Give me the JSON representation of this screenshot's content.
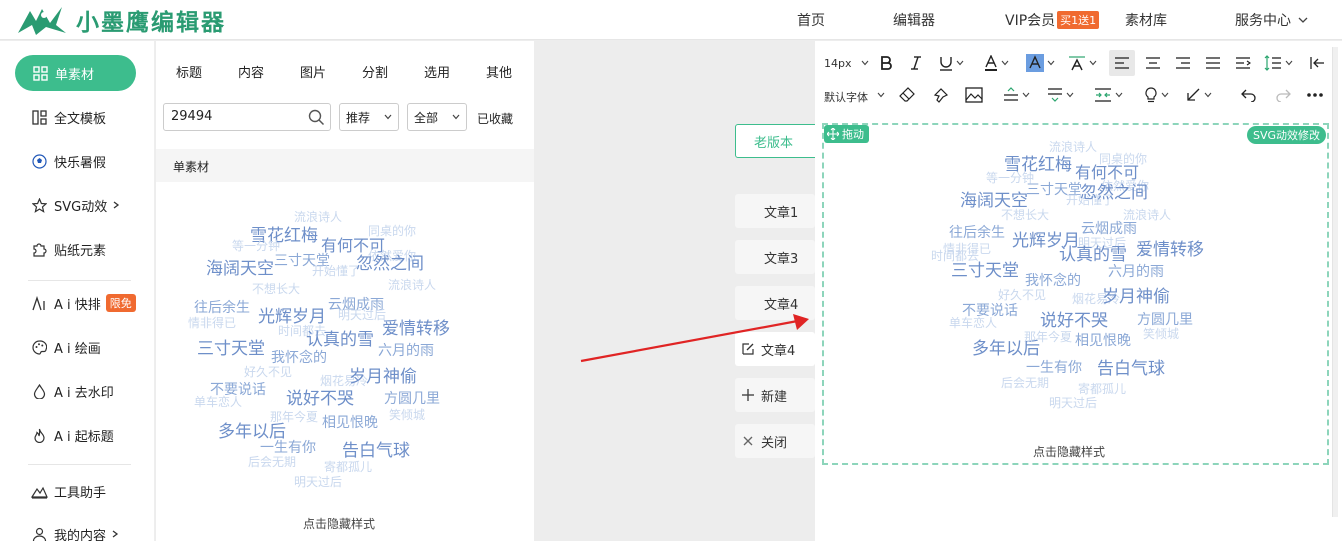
{
  "app": {
    "title": "小墨鹰编辑器",
    "brand_color": "#2a9b72",
    "accent": "#3dbd8d"
  },
  "topnav": {
    "home": "首页",
    "editor": "编辑器",
    "vip": "VIP会员",
    "vip_badge": "买1送1",
    "library": "素材库",
    "service": "服务中心"
  },
  "sidebar": {
    "items": [
      {
        "label": "单素材",
        "icon": "grid-icon"
      },
      {
        "label": "全文模板",
        "icon": "template-icon"
      },
      {
        "label": "快乐暑假",
        "icon": "ball-icon"
      },
      {
        "label": "SVG动效",
        "icon": "star-icon"
      },
      {
        "label": "贴纸元素",
        "icon": "puzzle-icon"
      },
      {
        "label": "A i 快排",
        "icon": "ai-icon",
        "badge": "限免"
      },
      {
        "label": "A i 绘画",
        "icon": "palette-icon"
      },
      {
        "label": "A i 去水印",
        "icon": "drop-icon"
      },
      {
        "label": "A i 起标题",
        "icon": "flame-icon"
      },
      {
        "label": "工具助手",
        "icon": "tool-icon"
      },
      {
        "label": "我的内容",
        "icon": "user-icon"
      }
    ]
  },
  "panel": {
    "tabs": [
      "标题",
      "内容",
      "图片",
      "分割",
      "选用",
      "其他"
    ],
    "search": {
      "value": "29494",
      "placeholder": ""
    },
    "sort": "推荐",
    "filter": "全部",
    "collected": "已收藏",
    "section": "单素材"
  },
  "cloud": {
    "hint": "点击隐藏样式",
    "words": [
      {
        "t": "流浪诗人",
        "s": "l"
      },
      {
        "t": "雪花红梅",
        "s": "x"
      },
      {
        "t": "同桌的你",
        "s": "l"
      },
      {
        "t": "有何不可",
        "s": "b"
      },
      {
        "t": "等一分钟",
        "s": "l"
      },
      {
        "t": "三寸天堂",
        "s": "m"
      },
      {
        "t": "依然爱你",
        "s": "l"
      },
      {
        "t": "海阔天空",
        "s": "x"
      },
      {
        "t": "开始懂了",
        "s": "l"
      },
      {
        "t": "忽然之间",
        "s": "x"
      },
      {
        "t": "不想长大",
        "s": "l"
      },
      {
        "t": "流浪诗人",
        "s": "l"
      },
      {
        "t": "往后余生",
        "s": "m"
      },
      {
        "t": "云烟成雨",
        "s": "m"
      },
      {
        "t": "情非得已",
        "s": "l"
      },
      {
        "t": "光辉岁月",
        "s": "x"
      },
      {
        "t": "明天过后",
        "s": "l"
      },
      {
        "t": "爱情转移",
        "s": "x"
      },
      {
        "t": "时间都去",
        "s": "l"
      },
      {
        "t": "认真的雪",
        "s": "x"
      },
      {
        "t": "三寸天堂",
        "s": "x"
      },
      {
        "t": "六月的雨",
        "s": "m"
      },
      {
        "t": "我怀念的",
        "s": "m"
      },
      {
        "t": "好久不见",
        "s": "l"
      },
      {
        "t": "烟花易冷",
        "s": "l"
      },
      {
        "t": "岁月神偷",
        "s": "x"
      },
      {
        "t": "不要说话",
        "s": "m"
      },
      {
        "t": "单车恋人",
        "s": "l"
      },
      {
        "t": "说好不哭",
        "s": "x"
      },
      {
        "t": "方圆几里",
        "s": "m"
      },
      {
        "t": "笑倾城",
        "s": "l"
      },
      {
        "t": "相见恨晚",
        "s": "m"
      },
      {
        "t": "多年以后",
        "s": "x"
      },
      {
        "t": "那年今夏",
        "s": "l"
      },
      {
        "t": "一生有你",
        "s": "m"
      },
      {
        "t": "告白气球",
        "s": "x"
      },
      {
        "t": "后会无期",
        "s": "l"
      },
      {
        "t": "寄都孤儿",
        "s": "l"
      },
      {
        "t": "明天过后",
        "s": "l"
      }
    ]
  },
  "middle": {
    "old_version": "老版本",
    "articles": [
      "文章1",
      "文章3",
      "文章4",
      "文章4"
    ],
    "new": "新建",
    "close": "关闭"
  },
  "editor": {
    "font_size": "14px",
    "font_family": "默认字体",
    "drag_tag": "拖动",
    "svg_tag": "SVG动效修改"
  }
}
